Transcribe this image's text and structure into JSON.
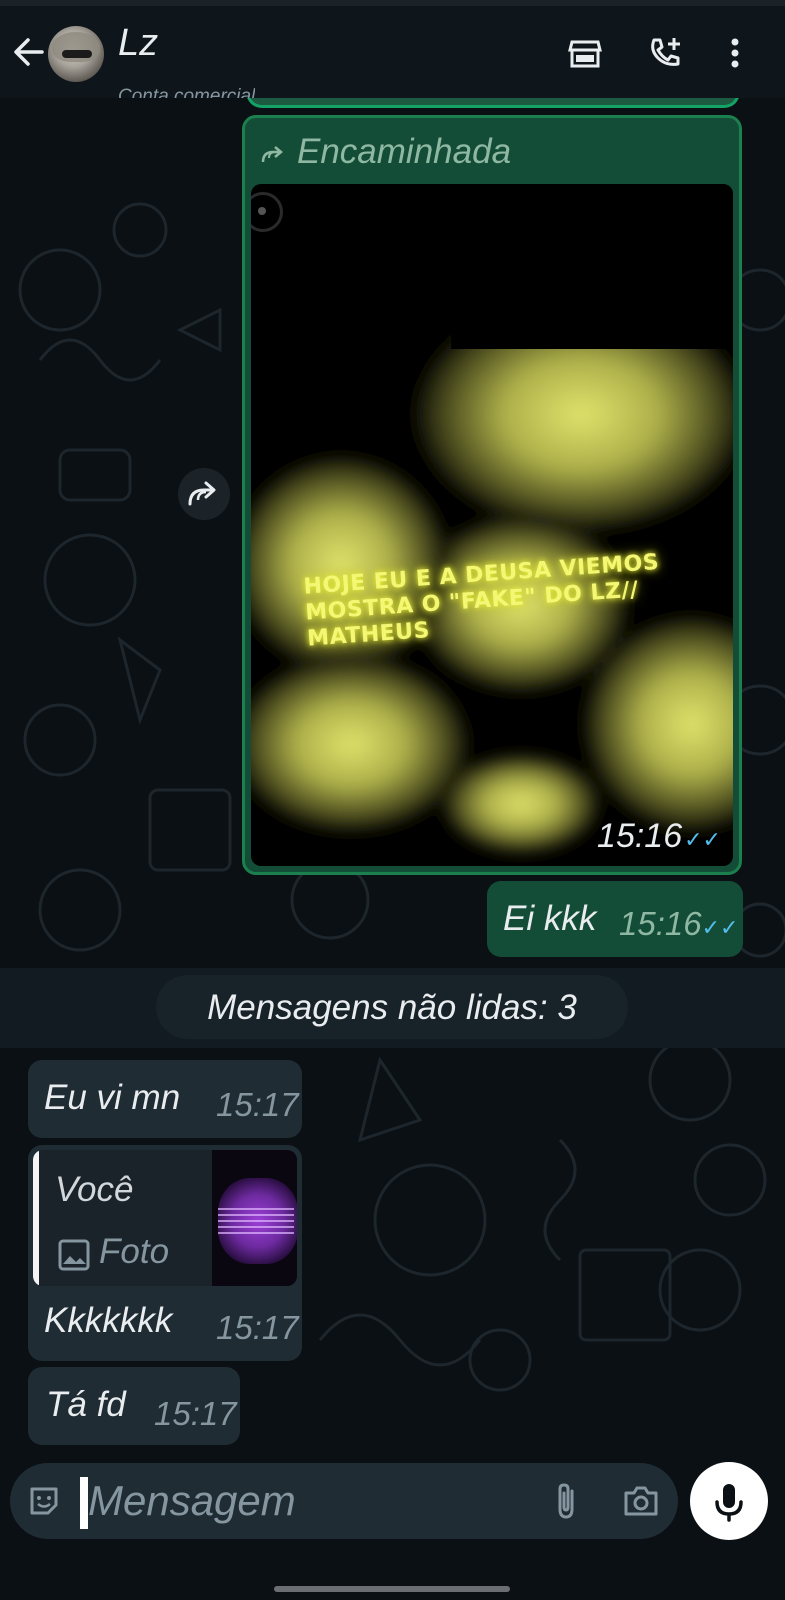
{
  "header": {
    "contact_name": "Lz",
    "contact_subtitle": "Conta comercial",
    "icons": [
      "back-arrow-icon",
      "store-icon",
      "add-call-icon",
      "more-vert-icon"
    ]
  },
  "messages": {
    "forwarded": {
      "label": "Encaminhada",
      "video_caption": "HOJE EU E A DEUSA VIEMOS MOSTRA O \"FAKE\" DO LZ// MATHEUS",
      "time": "15:16",
      "ticks": "✓✓"
    },
    "out_text": {
      "text": "Ei kkk",
      "time": "15:16",
      "ticks": "✓✓"
    },
    "unread_divider": "Mensagens não lidas: 3",
    "in_1": {
      "text": "Eu vi mn",
      "time": "15:17"
    },
    "in_2": {
      "quote_author": "Você",
      "quote_type": "Foto",
      "text": "Kkkkkkk",
      "time": "15:17"
    },
    "in_3": {
      "text": "Tá fd",
      "time": "15:17"
    }
  },
  "composer": {
    "placeholder": "Mensagem"
  },
  "colors": {
    "header_bg": "#0f161b",
    "chat_bg": "#0b1014",
    "outgoing_bubble": "#144d37",
    "incoming_bubble": "#1f2c33",
    "read_ticks": "#53bdeb",
    "glow_text": "#f4f774"
  }
}
